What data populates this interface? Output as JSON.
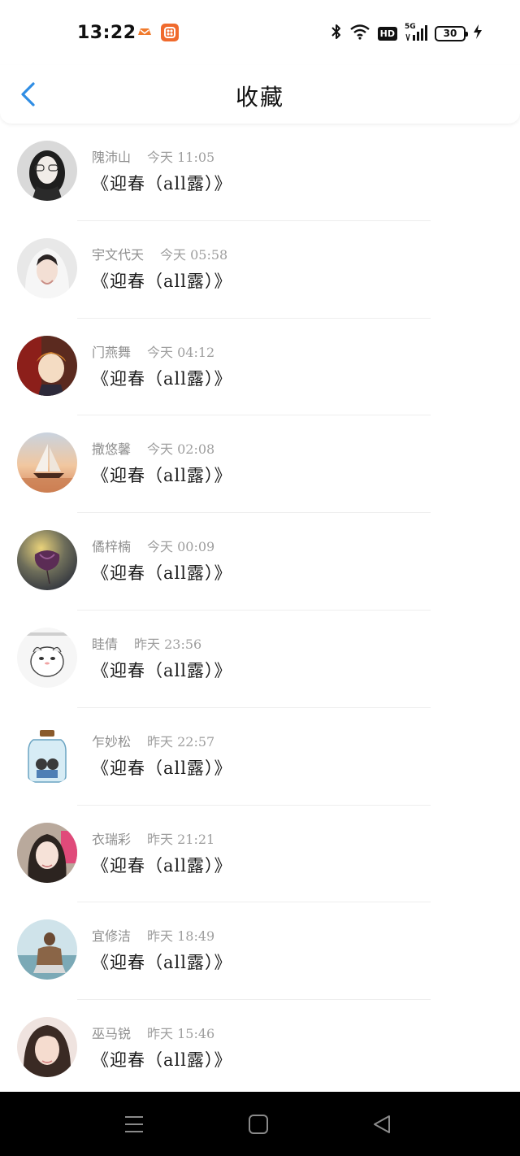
{
  "status_bar": {
    "time": "13:22",
    "network_badge": "HD",
    "cellular_label": "5G",
    "battery_level": "30",
    "icons": [
      "game-app-icon",
      "orange-app-icon",
      "bluetooth-icon",
      "wifi-icon",
      "signal-icon",
      "battery-icon",
      "charging-icon"
    ]
  },
  "header": {
    "title": "收藏",
    "back_icon": "chevron-left-icon",
    "accent_color": "#2f8de4"
  },
  "items": [
    {
      "name": "隗沛山",
      "time": "今天 11:05",
      "title": "《迎春（all露）》"
    },
    {
      "name": "宇文代天",
      "time": "今天 05:58",
      "title": "《迎春（all露）》"
    },
    {
      "name": "门燕舞",
      "time": "今天 04:12",
      "title": "《迎春（all露）》"
    },
    {
      "name": "撒悠馨",
      "time": "今天 02:08",
      "title": "《迎春（all露）》"
    },
    {
      "name": "僪梓楠",
      "time": "今天 00:09",
      "title": "《迎春（all露）》"
    },
    {
      "name": "眭倩",
      "time": "昨天 23:56",
      "title": "《迎春（all露）》"
    },
    {
      "name": "乍妙松",
      "time": "昨天 22:57",
      "title": "《迎春（all露）》"
    },
    {
      "name": "衣瑞彩",
      "time": "昨天 21:21",
      "title": "《迎春（all露）》"
    },
    {
      "name": "宜修洁",
      "time": "昨天 18:49",
      "title": "《迎春（all露）》"
    },
    {
      "name": "巫马锐",
      "time": "昨天 15:46",
      "title": "《迎春（all露）》"
    }
  ],
  "nav_bar": {
    "icons": [
      "menu-icon",
      "home-icon",
      "back-triangle-icon"
    ]
  }
}
